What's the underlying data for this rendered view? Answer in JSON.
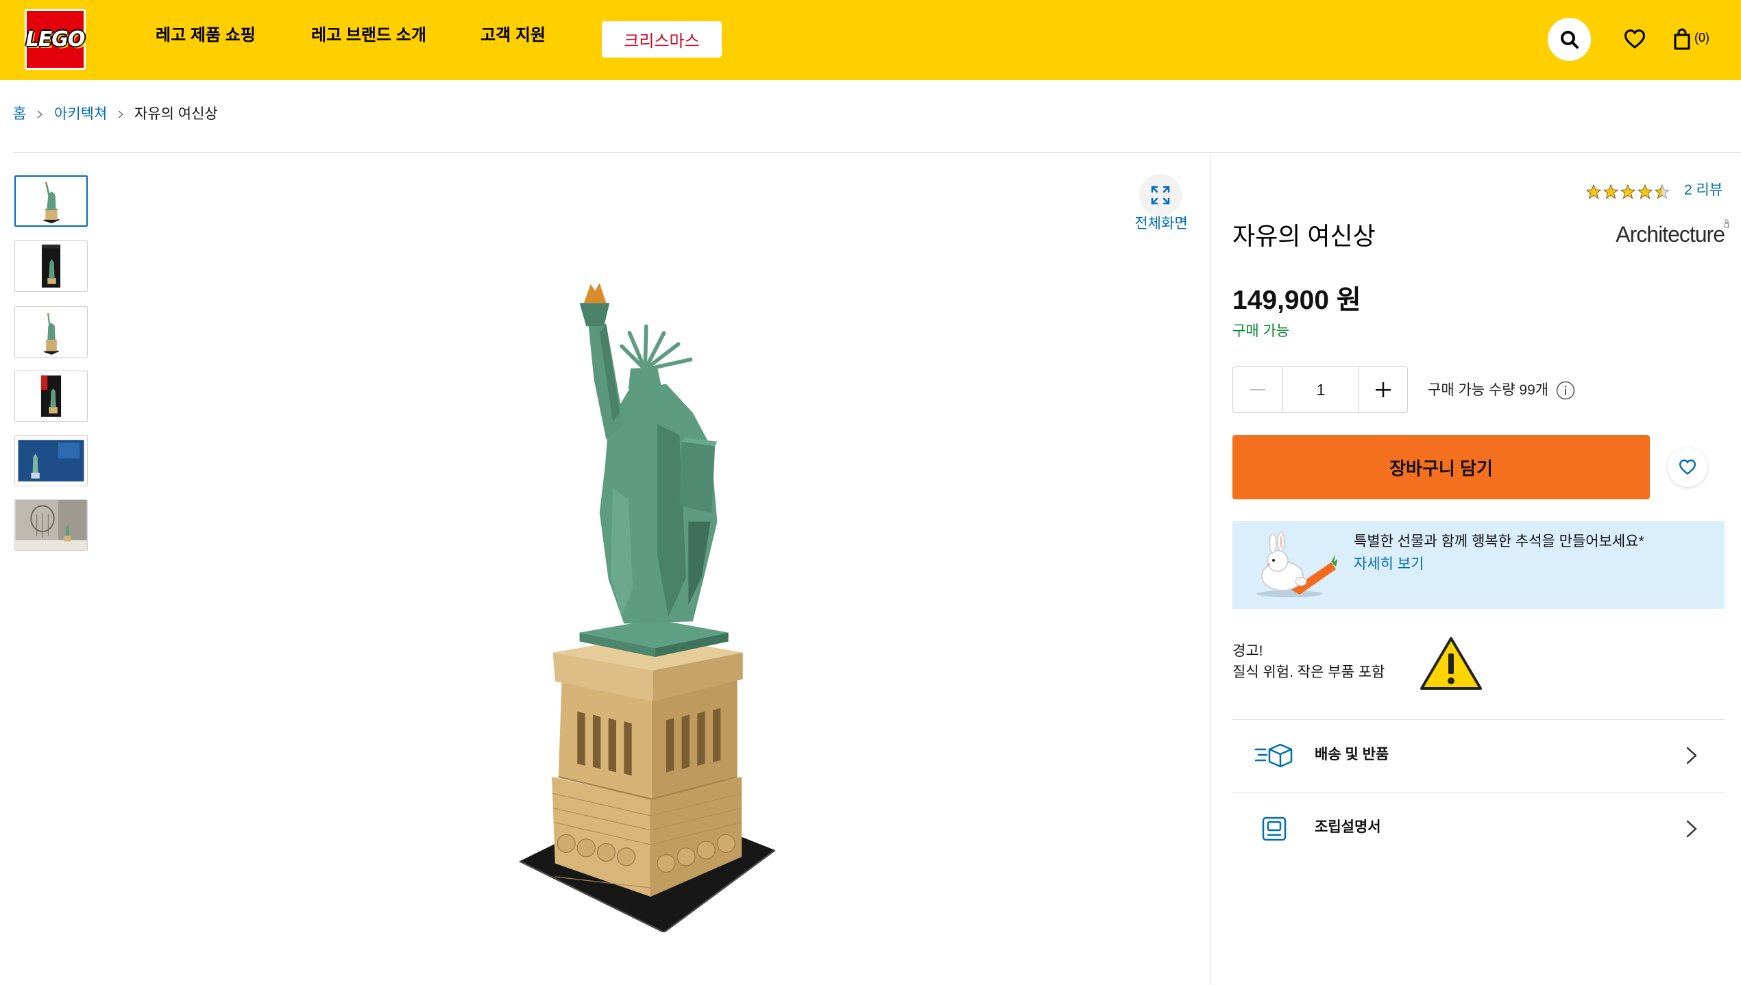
{
  "colors": {
    "header_bg": "#FFCF00",
    "logo_red": "#E3000B",
    "link_blue": "#006DB7",
    "cta_orange": "#F5701E",
    "available_green": "#00852B",
    "promo_bg": "#DBEEFC",
    "star": "#F5C518",
    "xmas_red": "#C8102E"
  },
  "header": {
    "logo_text": "LEGO",
    "nav": [
      {
        "label": "레고 제품 쇼핑"
      },
      {
        "label": "레고 브랜드 소개"
      },
      {
        "label": "고객 지원"
      }
    ],
    "promo_button": "크리스마스",
    "icons": {
      "search": "search-icon",
      "wishlist": "heart-icon",
      "cart": "shopping-bag-icon"
    },
    "cart_count": "(0)"
  },
  "breadcrumb": [
    {
      "label": "홈"
    },
    {
      "label": "아키텍쳐"
    },
    {
      "label": "자유의 여신상"
    }
  ],
  "breadcrumb_separator_icon": "chevron-right-icon",
  "gallery": {
    "fullscreen_icon": "expand-icon",
    "fullscreen_label": "전체화면"
  },
  "product": {
    "rating": 4.5,
    "rating_max": 5,
    "reviews_label": "2 리뷰",
    "title": "자유의 여신상",
    "brand_logo": "Architecture",
    "price": "149,900 원",
    "availability": "구매 가능",
    "quantity": "1",
    "max_quantity_label": "구매 가능 수량 99개",
    "info_icon": "info-icon",
    "add_to_cart": "장바구니 담기",
    "wishlist_icon": "heart-outline-icon"
  },
  "promo": {
    "text": "특별한 선물과 함께 행복한 추석을 만들어보세요*",
    "link": "자세히 보기"
  },
  "warning": {
    "title": "경고!",
    "text": "질식 위험. 작은 부품 포함",
    "icon": "warning-triangle-icon"
  },
  "sections": [
    {
      "label": "배송 및 반품",
      "icon": "delivery-box-icon"
    },
    {
      "label": "조립설명서",
      "icon": "instructions-icon"
    }
  ]
}
